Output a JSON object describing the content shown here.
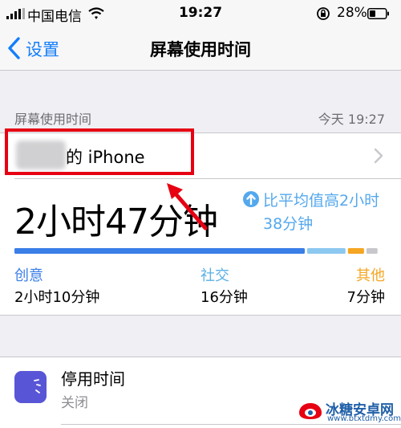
{
  "status_bar": {
    "carrier": "中国电信",
    "time": "19:27",
    "battery_percent": "28%"
  },
  "nav": {
    "back_label": "设置",
    "title": "屏幕使用时间"
  },
  "section": {
    "header": "屏幕使用时间",
    "date": "今天 19:27"
  },
  "device": {
    "name": "的 iPhone"
  },
  "summary": {
    "total_time": "2小时47分钟",
    "comparison": "比平均值高2小时38分钟"
  },
  "usage_bar": {
    "segments": [
      {
        "category": "创意",
        "fraction": 0.79,
        "color": "#3a7ee8"
      },
      {
        "category": "社交",
        "fraction": 0.11,
        "color": "#8cc8f0"
      },
      {
        "category": "其他",
        "fraction": 0.05,
        "color": "#f5a623"
      },
      {
        "category": "",
        "fraction": 0.03,
        "color": "#c8c7cc"
      }
    ]
  },
  "categories": [
    {
      "label": "创意",
      "value": "2小时10分钟",
      "color": "#3a7ee8"
    },
    {
      "label": "社交",
      "value": "16分钟",
      "color": "#5ab0e6"
    },
    {
      "label": "其他",
      "value": "7分钟",
      "color": "#f5a623"
    }
  ],
  "downtime": {
    "title": "停用时间",
    "status": "关闭"
  },
  "watermark": {
    "name": "冰糖安卓网",
    "url": "www.btxtdmy.com"
  }
}
